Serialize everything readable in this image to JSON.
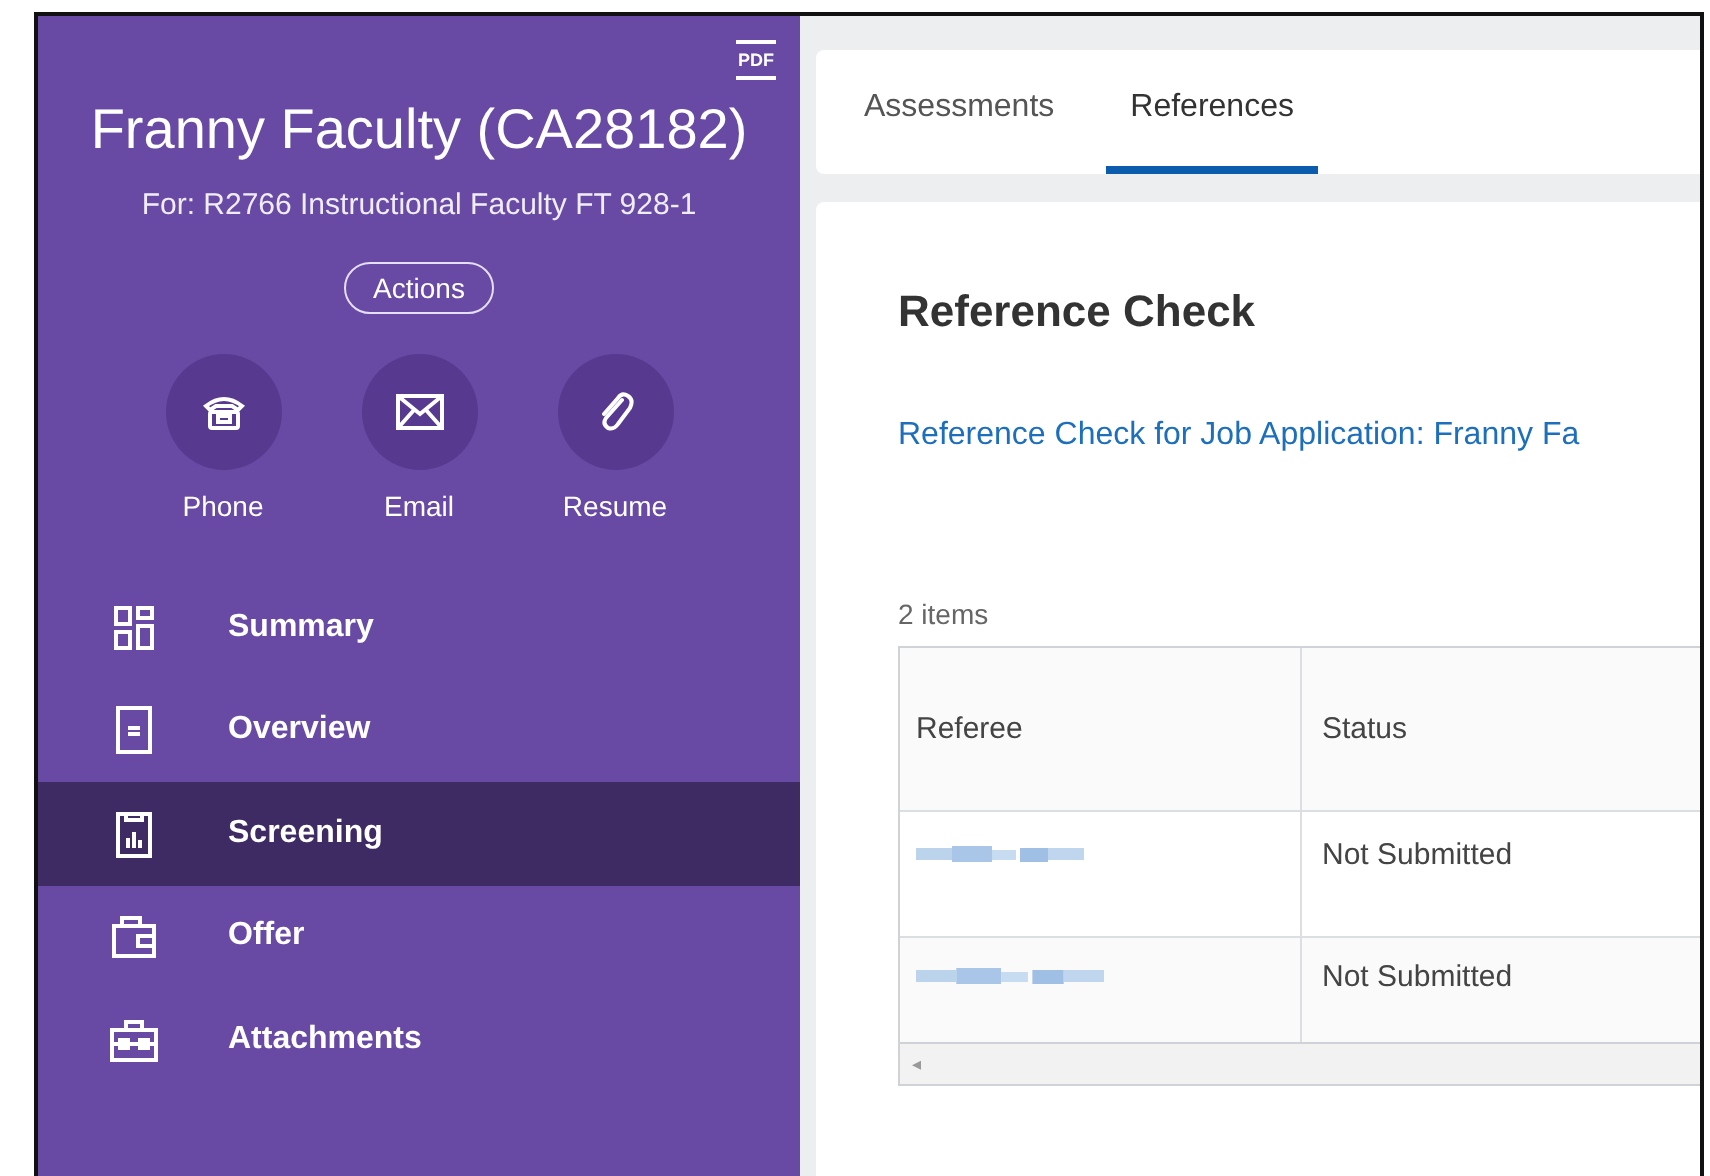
{
  "header": {
    "pdf_label": "PDF",
    "title": "Franny Faculty (CA28182)",
    "subtitle": "For: R2766 Instructional Faculty FT 928-1",
    "actions_button": "Actions"
  },
  "contact_buttons": [
    {
      "kind": "phone",
      "label": "Phone"
    },
    {
      "kind": "email",
      "label": "Email"
    },
    {
      "kind": "resume",
      "label": "Resume"
    }
  ],
  "sidebar": {
    "items": [
      {
        "kind": "summary",
        "label": "Summary",
        "selected": false
      },
      {
        "kind": "overview",
        "label": "Overview",
        "selected": false
      },
      {
        "kind": "screening",
        "label": "Screening",
        "selected": true
      },
      {
        "kind": "offer",
        "label": "Offer",
        "selected": false
      },
      {
        "kind": "attachments",
        "label": "Attachments",
        "selected": false
      }
    ]
  },
  "tabs": [
    {
      "label": "Assessments",
      "selected": false
    },
    {
      "label": "References",
      "selected": true
    }
  ],
  "section": {
    "title": "Reference Check",
    "link": "Reference Check for Job Application: Franny Fa",
    "count": "2 items"
  },
  "table": {
    "columns": [
      "Referee",
      "Status"
    ],
    "rows": [
      {
        "status": "Not Submitted"
      },
      {
        "status": "Not Submitted"
      }
    ],
    "scroll_left": "◂"
  }
}
